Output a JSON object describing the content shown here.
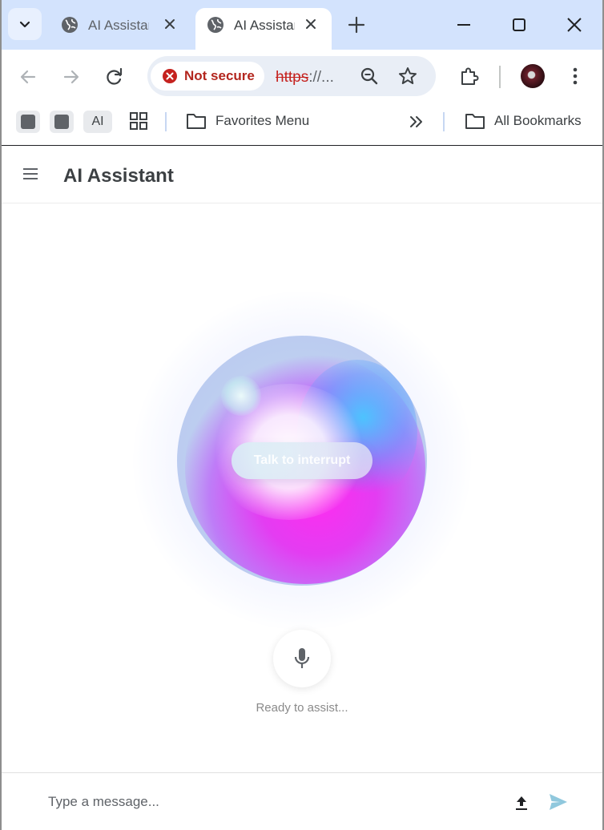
{
  "browser": {
    "tabs": [
      {
        "title": "AI Assistant",
        "active": false
      },
      {
        "title": "AI Assistant",
        "active": true
      }
    ],
    "address": {
      "security_label": "Not secure",
      "url_scheme": "https",
      "url_rest": "://..."
    },
    "bookmarks": {
      "ai_label": "AI",
      "favorites_label": "Favorites Menu",
      "all_bookmarks_label": "All Bookmarks"
    }
  },
  "app": {
    "title": "AI Assistant",
    "orb": {
      "interrupt_label": "Talk to interrupt"
    },
    "status_text": "Ready to assist...",
    "composer": {
      "placeholder": "Type a message..."
    }
  },
  "colors": {
    "tabstrip": "#d3e3fd",
    "not_secure": "#b3261e",
    "send_accent": "#90c8dd",
    "orb_magenta": "#ff2cf0",
    "orb_cyan": "#46c8ff"
  },
  "icons": [
    "tab-search-icon",
    "globe-icon",
    "close-icon",
    "plus-icon",
    "minimize-icon",
    "maximize-icon",
    "back-icon",
    "forward-icon",
    "reload-icon",
    "error-icon",
    "zoom-out-icon",
    "star-icon",
    "extensions-icon",
    "kebab-menu-icon",
    "apps-grid-icon",
    "folder-icon",
    "chevrons-right-icon",
    "hamburger-icon",
    "microphone-icon",
    "upload-icon",
    "send-icon"
  ]
}
